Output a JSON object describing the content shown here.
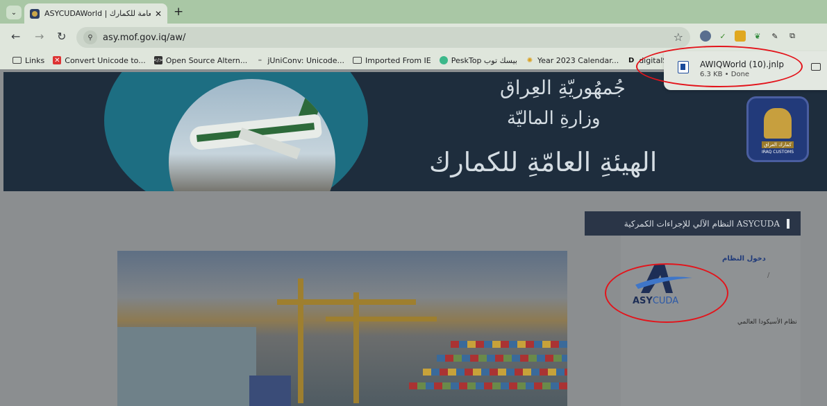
{
  "tab": {
    "title": "ASYCUDAWorld | العامة للكمارك",
    "close": "✕",
    "new_tab": "+"
  },
  "toolbar": {
    "url": "asy.mof.gov.iq/aw/",
    "back": "←",
    "forward": "→",
    "reload": "↻",
    "star": "☆",
    "site_info": "⚲"
  },
  "bookmarks": [
    {
      "label": "Links",
      "icon": "folder-icon"
    },
    {
      "label": "Convert Unicode to...",
      "icon": "red-x-icon"
    },
    {
      "label": "Open Source Altern...",
      "icon": "code-icon"
    },
    {
      "label": "jUniConv: Unicode...",
      "icon": "uniconv-icon"
    },
    {
      "label": "Imported From IE",
      "icon": "folder-icon"
    },
    {
      "label": "PeskTop بيسك توب",
      "icon": "pesktop-icon"
    },
    {
      "label": "Year 2023 Calendar...",
      "icon": "calendar-icon"
    },
    {
      "label": "digitalSamaritan | H...",
      "icon": "d-icon"
    }
  ],
  "download": {
    "filename": "AWIQWorld (10).jnlp",
    "meta": "6.3 KB • Done"
  },
  "banner": {
    "line1": "جُمهُوريّةِ العِراق",
    "line2": "وزارةِ الماليّة",
    "line3": "الهيئةِ العامّةِ للكمارك",
    "emblem_text": "كمارك العراق",
    "emblem_sub": "IRAQ CUSTOMS"
  },
  "sidebar": {
    "title": "ASYCUDA النظام الآلي للإجراءات الكمركية",
    "login_link": "دخول النظام",
    "slash": "/",
    "logo_bold": "ASY",
    "logo_light": "CUDA",
    "caption": "نظام الأسيكودا العالمي"
  },
  "colors": {
    "annotation": "#e3141b",
    "banner_bg": "#1e2d3d",
    "sidebar_header": "#2a3547"
  }
}
